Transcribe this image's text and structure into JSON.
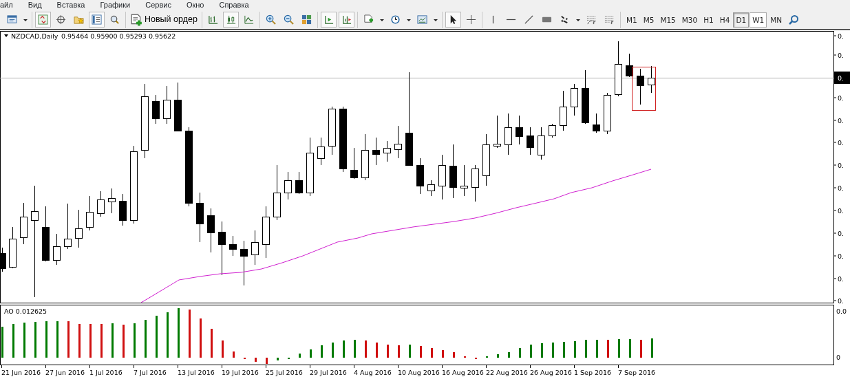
{
  "menu": [
    {
      "label": "айл"
    },
    {
      "label": "Вид"
    },
    {
      "label": "Вставка"
    },
    {
      "label": "Графики"
    },
    {
      "label": "Сервис"
    },
    {
      "label": "Окно"
    },
    {
      "label": "Справка"
    }
  ],
  "toolbar": [
    [
      {
        "kind": "profiles",
        "pressed": false
      },
      {
        "kind": "caret"
      }
    ],
    [
      {
        "kind": "market_watch",
        "pressed": true
      },
      {
        "kind": "crosshair",
        "pressed": false
      },
      {
        "kind": "navigator",
        "pressed": false
      },
      {
        "kind": "terminal",
        "pressed": true
      },
      {
        "kind": "tester",
        "pressed": false
      }
    ],
    [
      {
        "kind": "new_order",
        "pressed": false,
        "label": "Новый ордер"
      }
    ],
    [
      {
        "kind": "bars",
        "pressed": false
      },
      {
        "kind": "candles",
        "pressed": true
      },
      {
        "kind": "line",
        "pressed": false
      }
    ],
    [
      {
        "kind": "zoom_in",
        "pressed": false
      },
      {
        "kind": "zoom_out",
        "pressed": false
      },
      {
        "kind": "tile",
        "pressed": false
      }
    ],
    [
      {
        "kind": "shift",
        "pressed": true
      },
      {
        "kind": "autoscroll",
        "pressed": true
      }
    ],
    [
      {
        "kind": "indicators",
        "pressed": false
      },
      {
        "kind": "caret"
      },
      {
        "kind": "periods",
        "pressed": false
      },
      {
        "kind": "caret"
      },
      {
        "kind": "templates",
        "pressed": false
      },
      {
        "kind": "caret"
      }
    ],
    [
      {
        "kind": "cursor",
        "pressed": true
      },
      {
        "kind": "cross",
        "pressed": false
      }
    ],
    [
      {
        "kind": "vline",
        "pressed": false
      },
      {
        "kind": "hline",
        "pressed": false
      },
      {
        "kind": "trendline",
        "pressed": false
      },
      {
        "kind": "rectangle",
        "pressed": false
      },
      {
        "kind": "arrows",
        "pressed": false
      },
      {
        "kind": "caret"
      },
      {
        "kind": "fibo_fan",
        "pressed": false
      },
      {
        "kind": "fibo",
        "pressed": false
      }
    ]
  ],
  "timeframes": [
    {
      "label": "M1",
      "selected": false,
      "hovered": false
    },
    {
      "label": "M5",
      "selected": false,
      "hovered": false
    },
    {
      "label": "M15",
      "selected": false,
      "hovered": false
    },
    {
      "label": "M30",
      "selected": false,
      "hovered": false
    },
    {
      "label": "H1",
      "selected": false,
      "hovered": false
    },
    {
      "label": "H4",
      "selected": false,
      "hovered": false
    },
    {
      "label": "D1",
      "selected": true,
      "hovered": false
    },
    {
      "label": "W1",
      "selected": false,
      "hovered": true
    },
    {
      "label": "MN",
      "selected": false,
      "hovered": false
    }
  ],
  "chart": {
    "symbol": "NZDCAD,Daily",
    "ohlc": "0.95464 0.95900 0.95293 0.95622",
    "price_axis_labels": [
      "0.",
      "0.",
      "0.",
      "0.",
      "0.",
      "0.",
      "0.",
      "0.",
      "0.",
      "0.",
      "0.",
      "0."
    ],
    "current_price_label": "0.",
    "indicator": {
      "title": "AO 0.012625",
      "axis_labels": [
        "0.0",
        "0"
      ]
    },
    "dates": [
      "21 Jun 2016",
      "27 Jun 2016",
      "1 Jul 2016",
      "7 Jul 2016",
      "13 Jul 2016",
      "19 Jul 2016",
      "25 Jul 2016",
      "29 Jul 2016",
      "4 Aug 2016",
      "10 Aug 2016",
      "16 Aug 2016",
      "22 Aug 2016",
      "26 Aug 2016",
      "1 Sep 2016",
      "7 Sep 2016"
    ]
  }
}
